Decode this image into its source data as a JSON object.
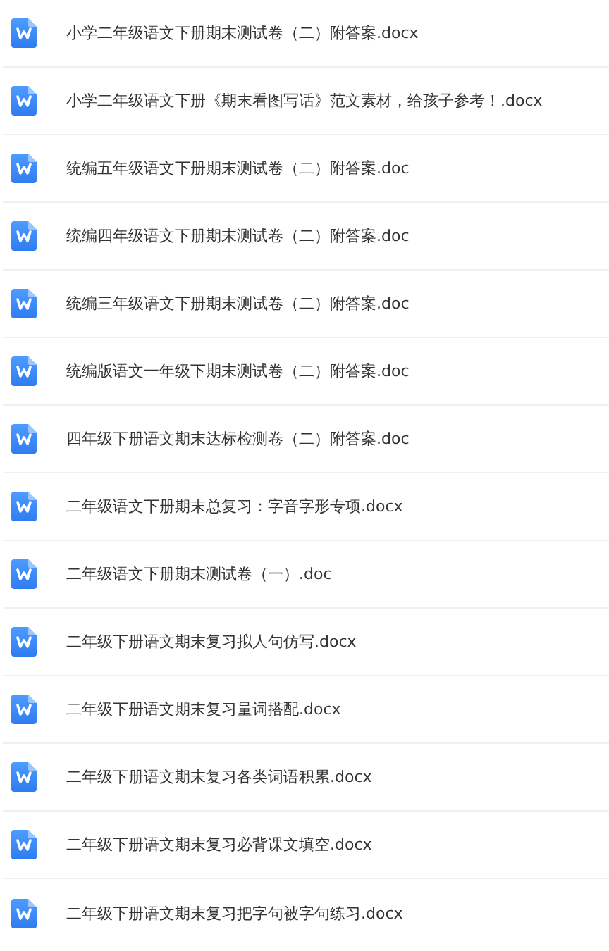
{
  "files": [
    {
      "name": "小学二年级语文下册期末测试卷（二）附答案.docx"
    },
    {
      "name": "小学二年级语文下册《期末看图写话》范文素材，给孩子参考！.docx"
    },
    {
      "name": "统编五年级语文下册期末测试卷（二）附答案.doc"
    },
    {
      "name": "统编四年级语文下册期末测试卷（二）附答案.doc"
    },
    {
      "name": "统编三年级语文下册期末测试卷（二）附答案.doc"
    },
    {
      "name": "统编版语文一年级下期末测试卷（二）附答案.doc"
    },
    {
      "name": "四年级下册语文期末达标检测卷（二）附答案.doc"
    },
    {
      "name": "二年级语文下册期末总复习：字音字形专项.docx"
    },
    {
      "name": "二年级语文下册期末测试卷（一）.doc"
    },
    {
      "name": "二年级下册语文期末复习拟人句仿写.docx"
    },
    {
      "name": "二年级下册语文期末复习量词搭配.docx"
    },
    {
      "name": "二年级下册语文期末复习各类词语积累.docx"
    },
    {
      "name": "二年级下册语文期末复习必背课文填空.docx"
    },
    {
      "name": "二年级下册语文期末复习把字句被字句练习.docx"
    }
  ]
}
